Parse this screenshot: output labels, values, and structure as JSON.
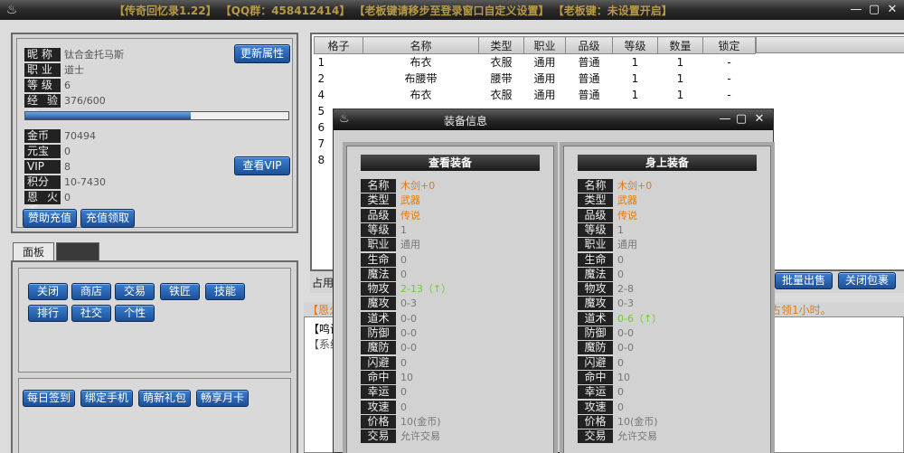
{
  "window": {
    "title": "【传奇回忆录1.22】 【QQ群：458412414】 【老板键请移步至登录窗口自定义设置】 【老板键：未设置开启】",
    "logo_icon": "game-logo-icon"
  },
  "char": {
    "rows": [
      {
        "label": "昵 称",
        "value": "钛合金托马斯"
      },
      {
        "label": "职 业",
        "value": "道士"
      },
      {
        "label": "等 级",
        "value": "6"
      },
      {
        "label": "经验值",
        "value": "376/600"
      }
    ],
    "exp_fraction": 0.63,
    "refresh_btn": "更新属性",
    "money": [
      {
        "label": "金币",
        "value": "70494"
      },
      {
        "label": "元宝",
        "value": "0"
      },
      {
        "label": "VIP",
        "value": "8"
      },
      {
        "label": "积分",
        "value": "10-7430"
      },
      {
        "label": "恩火币",
        "value": "0"
      }
    ],
    "vip_btn": "查看VIP",
    "sponsor_btn": "赞助充值",
    "recharge_btn": "充值领取"
  },
  "tabs": {
    "panel": "面板",
    "second": ""
  },
  "panel_buttons1": [
    "关闭",
    "商店",
    "交易",
    "铁匠",
    "技能"
  ],
  "panel_buttons2": [
    "排行",
    "社交",
    "个性"
  ],
  "panel_buttons3": [
    "每日签到",
    "绑定手机",
    "萌新礼包",
    "畅享月卡"
  ],
  "inventory": {
    "headers": [
      "格子",
      "名称",
      "类型",
      "职业",
      "品级",
      "等级",
      "数量",
      "锁定"
    ],
    "rows": [
      [
        "1",
        "布衣",
        "衣服",
        "通用",
        "普通",
        "1",
        "1",
        "-"
      ],
      [
        "2",
        "布腰带",
        "腰带",
        "通用",
        "普通",
        "1",
        "1",
        "-"
      ],
      [
        "4",
        "布衣",
        "衣服",
        "通用",
        "普通",
        "1",
        "1",
        "-"
      ],
      [
        "5",
        "",
        "",
        "",
        "",
        "",
        "",
        ""
      ],
      [
        "6",
        "",
        "",
        "",
        "",
        "",
        "",
        ""
      ],
      [
        "7",
        "",
        "",
        "",
        "",
        "",
        "",
        ""
      ],
      [
        "8",
        "",
        "",
        "",
        "",
        "",
        "",
        ""
      ]
    ],
    "occupy_label": "占用",
    "bulk_sell_btn": "批量出售",
    "close_bag_btn": "关闭包裹"
  },
  "notice": {
    "left": "【恩火",
    "right": "占领1小时。"
  },
  "log": {
    "line1": "【鸣调",
    "line2": "【系统"
  },
  "dialog": {
    "title": "装备信息",
    "left": {
      "header": "查看装备",
      "rows": [
        {
          "k": "名称",
          "v": "木剑+0",
          "c": "#e07a10"
        },
        {
          "k": "类型",
          "v": "武器",
          "c": "#e07a10"
        },
        {
          "k": "品级",
          "v": "传说",
          "c": "#e07a10"
        },
        {
          "k": "等级",
          "v": "1",
          "c": "#777"
        },
        {
          "k": "职业",
          "v": "通用",
          "c": "#777"
        },
        {
          "k": "生命",
          "v": "0",
          "c": "#777"
        },
        {
          "k": "魔法",
          "v": "0",
          "c": "#777"
        },
        {
          "k": "物攻",
          "v": "2-13（↑）",
          "c": "#6ecb2a"
        },
        {
          "k": "魔攻",
          "v": "0-3",
          "c": "#777"
        },
        {
          "k": "道术",
          "v": "0-0",
          "c": "#777"
        },
        {
          "k": "防御",
          "v": "0-0",
          "c": "#777"
        },
        {
          "k": "魔防",
          "v": "0-0",
          "c": "#777"
        },
        {
          "k": "闪避",
          "v": "0",
          "c": "#777"
        },
        {
          "k": "命中",
          "v": "10",
          "c": "#777"
        },
        {
          "k": "幸运",
          "v": "0",
          "c": "#777"
        },
        {
          "k": "攻速",
          "v": "0",
          "c": "#777"
        },
        {
          "k": "价格",
          "v": "10(金币)",
          "c": "#777"
        },
        {
          "k": "交易",
          "v": "允许交易",
          "c": "#777"
        }
      ]
    },
    "right": {
      "header": "身上装备",
      "rows": [
        {
          "k": "名称",
          "v": "木剑+0",
          "c": "#e07a10"
        },
        {
          "k": "类型",
          "v": "武器",
          "c": "#e07a10"
        },
        {
          "k": "品级",
          "v": "传说",
          "c": "#e07a10"
        },
        {
          "k": "等级",
          "v": "1",
          "c": "#777"
        },
        {
          "k": "职业",
          "v": "通用",
          "c": "#777"
        },
        {
          "k": "生命",
          "v": "0",
          "c": "#777"
        },
        {
          "k": "魔法",
          "v": "0",
          "c": "#777"
        },
        {
          "k": "物攻",
          "v": "2-8",
          "c": "#777"
        },
        {
          "k": "魔攻",
          "v": "0-3",
          "c": "#777"
        },
        {
          "k": "道术",
          "v": "0-6（↑）",
          "c": "#6ecb2a"
        },
        {
          "k": "防御",
          "v": "0-0",
          "c": "#777"
        },
        {
          "k": "魔防",
          "v": "0-0",
          "c": "#777"
        },
        {
          "k": "闪避",
          "v": "0",
          "c": "#777"
        },
        {
          "k": "命中",
          "v": "10",
          "c": "#777"
        },
        {
          "k": "幸运",
          "v": "0",
          "c": "#777"
        },
        {
          "k": "攻速",
          "v": "0",
          "c": "#777"
        },
        {
          "k": "价格",
          "v": "10(金币)",
          "c": "#777"
        },
        {
          "k": "交易",
          "v": "允许交易",
          "c": "#777"
        }
      ]
    }
  }
}
